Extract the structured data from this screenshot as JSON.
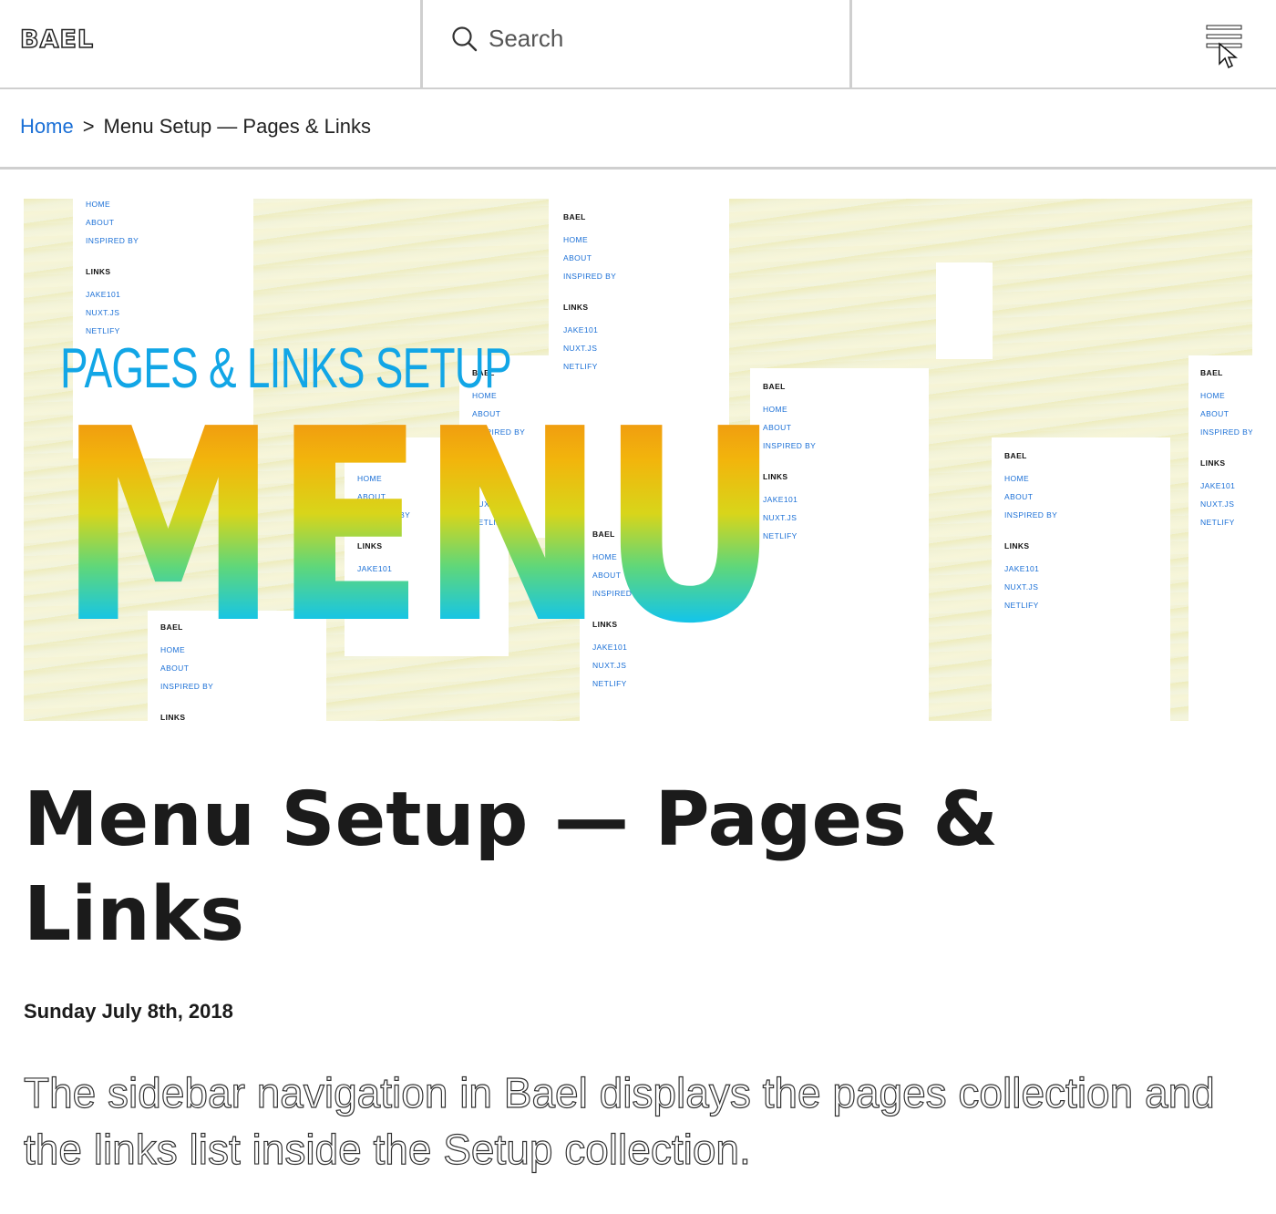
{
  "header": {
    "logo": "BAEL",
    "search_placeholder": "Search",
    "icons": {
      "search": "search-icon",
      "menu": "hamburger-menu-icon"
    }
  },
  "breadcrumb": {
    "home": "Home",
    "separator": ">",
    "current": "Menu Setup — Pages & Links"
  },
  "hero": {
    "subtitle": "PAGES & LINKS SETUP",
    "word": "MENU",
    "menu_sample": {
      "brand": "BAEL",
      "pages": [
        "HOME",
        "ABOUT",
        "INSPIRED BY"
      ],
      "links_heading": "LINKS",
      "links": [
        "JAKE101",
        "NUXT.JS",
        "NETLIFY"
      ]
    },
    "colors": {
      "subtitle": "#12a6e6",
      "gradient_top": "#ef8a13",
      "gradient_bottom": "#0bb6ee",
      "link": "#1a6fd6"
    }
  },
  "article": {
    "title": "Menu Setup — Pages & Links",
    "date": "Sunday July 8th, 2018",
    "intro": "The sidebar navigation in Bael displays the pages collection and the links list inside the Setup collection."
  }
}
